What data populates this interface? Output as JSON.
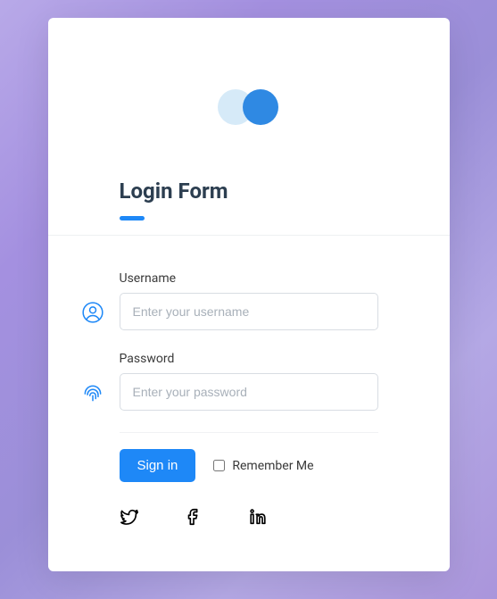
{
  "title": "Login Form",
  "fields": {
    "username": {
      "label": "Username",
      "placeholder": "Enter your username",
      "value": ""
    },
    "password": {
      "label": "Password",
      "placeholder": "Enter your password",
      "value": ""
    }
  },
  "actions": {
    "signin_label": "Sign in",
    "remember_label": "Remember Me"
  },
  "social": {
    "twitter": "twitter",
    "facebook": "facebook",
    "linkedin": "linkedin"
  },
  "colors": {
    "accent": "#1e88f7",
    "logo_light": "#d6eaf8",
    "logo_dark": "#2f89e3"
  }
}
